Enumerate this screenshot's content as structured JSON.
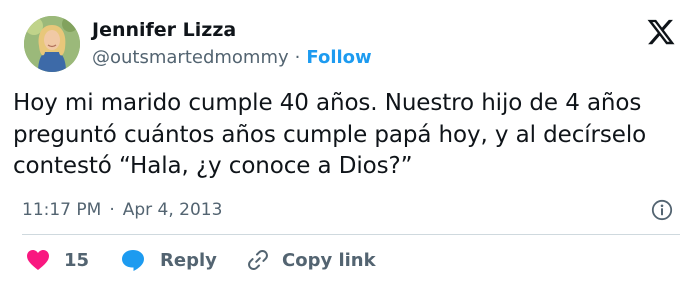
{
  "author": {
    "name": "Jennifer Lizza",
    "handle": "@outsmartedmommy",
    "separator": "·",
    "follow_label": "Follow"
  },
  "tweet": {
    "lines": [
      "Hoy mi marido cumple 40 años. Nuestro hijo de 4 años",
      "preguntó cuántos años cumple papá hoy, y al decírselo",
      "contestó “Hala, ¿y conoce a Dios?”"
    ]
  },
  "meta": {
    "time": "11:17 PM",
    "separator": "·",
    "date": "Apr 4, 2013"
  },
  "actions": {
    "like_count": "15",
    "reply_label": "Reply",
    "copy_link_label": "Copy link"
  },
  "icons": {
    "brand": "x-logo-icon",
    "info": "info-icon",
    "like": "heart-icon",
    "reply": "speech-bubble-icon",
    "copy": "link-icon"
  },
  "colors": {
    "text": "#0f1419",
    "secondary": "#536471",
    "accent": "#1d9bf0",
    "like": "#f91880",
    "divider": "#cfd9de"
  }
}
